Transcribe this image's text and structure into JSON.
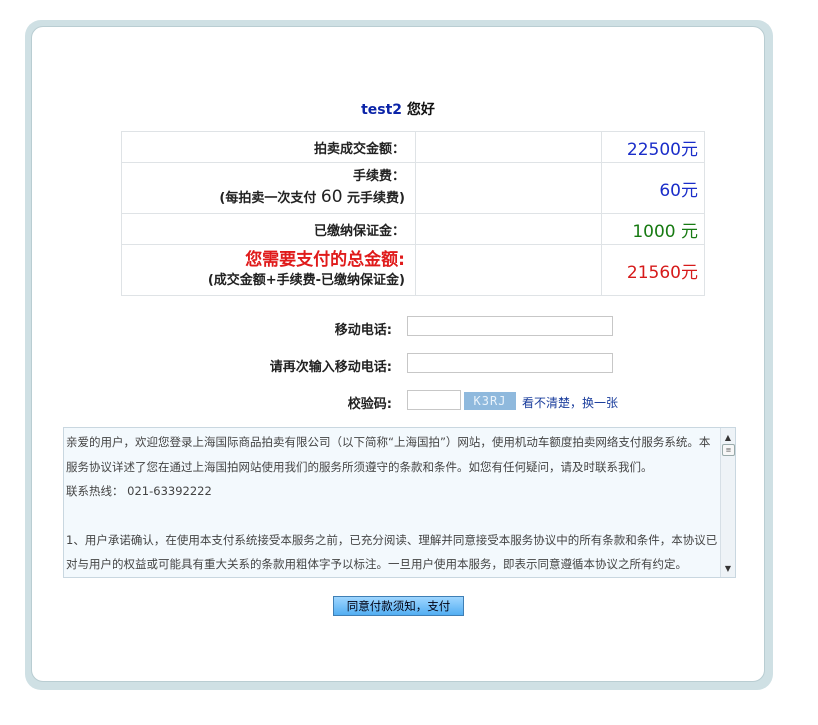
{
  "greeting": {
    "user": "test2",
    "suffix": "您好"
  },
  "summary": {
    "deal_amount_label": "拍卖成交金额：",
    "deal_amount_value": "22500元",
    "fee_label": "手续费：",
    "fee_note_prefix": "(每拍卖一次支付",
    "fee_note_amount": "60",
    "fee_note_suffix": "元手续费)",
    "fee_value": "60元",
    "deposit_label": "已缴纳保证金：",
    "deposit_value": "1000 元",
    "total_label": "您需要支付的总金额:",
    "total_formula": "(成交金额+手续费-已缴纳保证金)",
    "total_value": "21560元"
  },
  "form": {
    "mobile_label": "移动电话:",
    "mobile_value": "",
    "mobile_confirm_label": "请再次输入移动电话:",
    "mobile_confirm_value": "",
    "captcha_label": "校验码:",
    "captcha_value": "",
    "captcha_image_text": "K3RJ",
    "captcha_refresh": "看不清楚，换一张"
  },
  "agreement": {
    "paragraph1": "亲爱的用户，欢迎您登录上海国际商品拍卖有限公司（以下简称“上海国拍”）网站，使用机动车额度拍卖网络支付服务系统。本服务协议详述了您在通过上海国拍网站使用我们的服务所须遵守的条款和条件。如您有任何疑问，请及时联系我们。",
    "hotline": "联系热线： 021-63392222",
    "paragraph2": "1、用户承诺确认，在使用本支付系统接受本服务之前，已充分阅读、理解并同意接受本服务协议中的所有条款和条件，本协议已对与用户的权益或可能具有重大关系的条款用粗体字予以标注。一旦用户使用本服务，即表示同意遵循本协议之所有约定。"
  },
  "submit_label": "同意付款须知，支付",
  "colors": {
    "frame": "#cfe0e4",
    "blue_value": "#1a2dc9",
    "green_value": "#177a12",
    "red_value": "#d61a1a",
    "username": "#0b24a8"
  }
}
